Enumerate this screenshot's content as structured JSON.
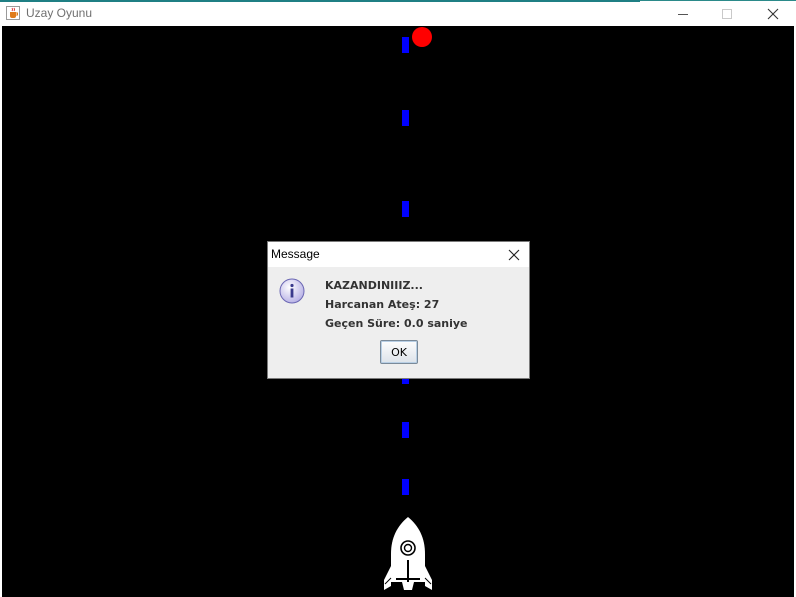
{
  "window": {
    "title": "Uzay Oyunu",
    "icon": "java-cup-icon",
    "controls": [
      "minimize-icon",
      "maximize-icon",
      "close-icon"
    ]
  },
  "game": {
    "background_color": "#000000",
    "bullet_color": "#0000ff",
    "enemy_color": "#ff0000",
    "player": "rocket-icon",
    "bullet_count": 7,
    "enemy_count": 1
  },
  "dialog": {
    "title": "Message",
    "icon": "info-icon",
    "lines": [
      "KAZANDINIIIZ...",
      "Harcanan Ateş: 27",
      "Geçen Süre: 0.0 saniye"
    ],
    "ok_label": "OK"
  }
}
